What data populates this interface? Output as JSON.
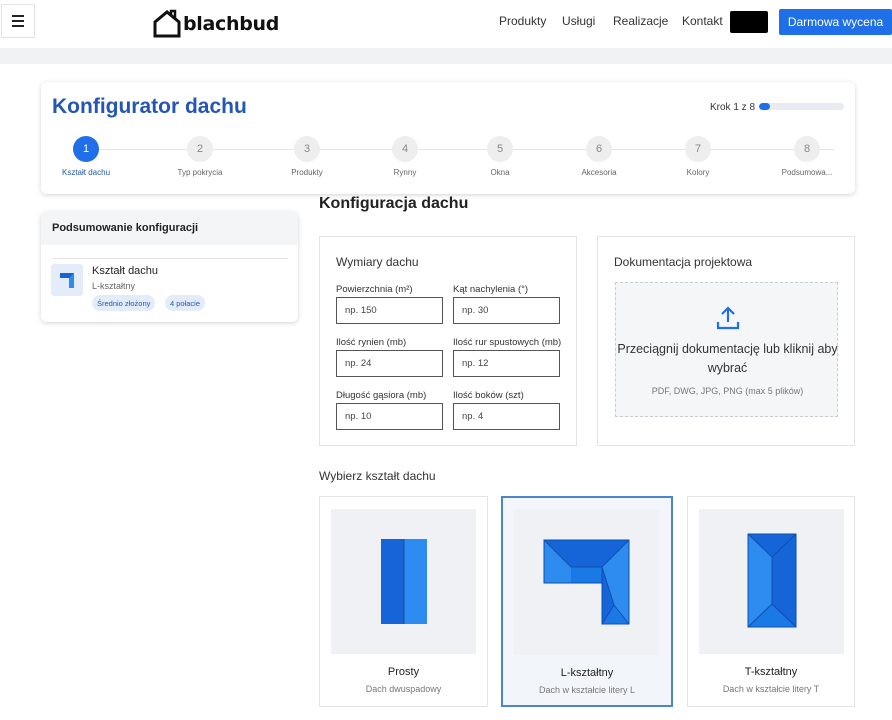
{
  "header": {
    "logo_text": "blachbud",
    "nav": [
      "Produkty",
      "Usługi",
      "Realizacje",
      "Kontakt"
    ],
    "cta_label": "Darmowa wycena"
  },
  "configurator": {
    "title": "Konfigurator dachu",
    "step_indicator": "Krok 1 z 8",
    "progress": 0.125,
    "steps": [
      {
        "number": "1",
        "label": "Kształt dachu",
        "active": true
      },
      {
        "number": "2",
        "label": "Typ pokrycia",
        "active": false
      },
      {
        "number": "3",
        "label": "Produkty",
        "active": false
      },
      {
        "number": "4",
        "label": "Rynny",
        "active": false
      },
      {
        "number": "5",
        "label": "Okna",
        "active": false
      },
      {
        "number": "6",
        "label": "Akcesoria",
        "active": false
      },
      {
        "number": "7",
        "label": "Kolory",
        "active": false
      },
      {
        "number": "8",
        "label": "Podsumowa...",
        "active": false
      }
    ]
  },
  "summary": {
    "title": "Podsumowanie konfiguracji",
    "item_title": "Kształt dachu",
    "item_value": "L-kształtny",
    "badges": [
      "Średnio złożony",
      "4 połacie"
    ]
  },
  "main": {
    "section_title": "Konfiguracja dachu",
    "dimensions": {
      "title": "Wymiary dachu",
      "fields": [
        {
          "label": "Powierzchnia (m²)",
          "placeholder": "np. 150"
        },
        {
          "label": "Kąt nachylenia (°)",
          "placeholder": "np. 30"
        },
        {
          "label": "Ilość rynien (mb)",
          "placeholder": "np. 24"
        },
        {
          "label": "Ilość rur spustowych (mb)",
          "placeholder": "np. 12"
        },
        {
          "label": "Długość gąsiora (mb)",
          "placeholder": "np. 10"
        },
        {
          "label": "Ilość boków (szt)",
          "placeholder": "np. 4"
        }
      ]
    },
    "documentation": {
      "title": "Dokumentacja projektowa",
      "dropzone_text": "Przeciągnij dokumentację lub kliknij aby wybrać",
      "hint": "PDF, DWG, JPG, PNG (max 5 plików)"
    },
    "shape_section_label": "Wybierz kształt dachu",
    "shapes": [
      {
        "name": "Prosty",
        "description": "Dach dwuspadowy",
        "selected": false
      },
      {
        "name": "L-kształtny",
        "description": "Dach w kształcie litery L",
        "selected": true
      },
      {
        "name": "T-kształtny",
        "description": "Dach w kształcie litery T",
        "selected": false
      }
    ]
  },
  "colors": {
    "accent": "#1f6fe8",
    "title_blue": "#2457b5",
    "roof_dark": "#1565d8",
    "roof_light": "#2e8cf0"
  },
  "icons": [
    "menu-icon",
    "logo-house-icon",
    "upload-icon",
    "l-shape-icon"
  ]
}
